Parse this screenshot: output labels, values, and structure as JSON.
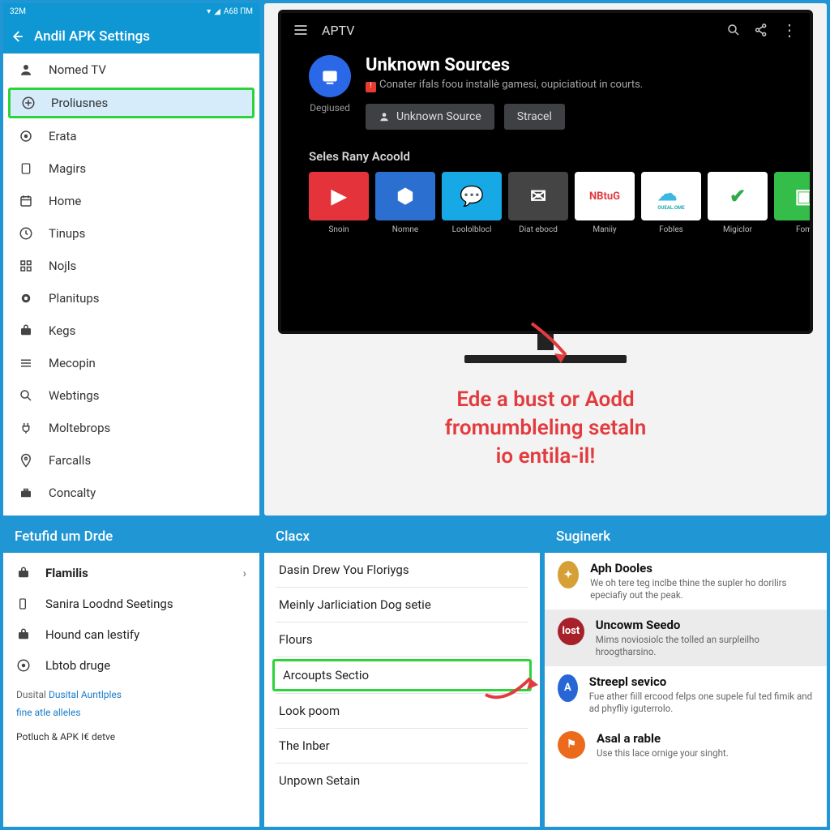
{
  "phone": {
    "status_time": "32M",
    "status_extra": "A68 ПM",
    "appbar_title": "Andil APK Settings",
    "items": [
      {
        "icon": "person",
        "label": "Nomed TV"
      },
      {
        "icon": "plus-circle",
        "label": "Proliusnes",
        "selected": true
      },
      {
        "icon": "target",
        "label": "Erata"
      },
      {
        "icon": "page",
        "label": "Magirs"
      },
      {
        "icon": "calendar",
        "label": "Home"
      },
      {
        "icon": "clock",
        "label": "Tinups"
      },
      {
        "icon": "squares",
        "label": "Nojls"
      },
      {
        "icon": "dot",
        "label": "Planitups"
      },
      {
        "icon": "briefcase",
        "label": "Kegs"
      },
      {
        "icon": "stack",
        "label": "Mecopin"
      },
      {
        "icon": "magnify",
        "label": "Webtings"
      },
      {
        "icon": "plug",
        "label": "Moltebrops"
      },
      {
        "icon": "pin",
        "label": "Farcalls"
      },
      {
        "icon": "case",
        "label": "Concalty"
      }
    ]
  },
  "tv": {
    "title": "APTV",
    "src_title": "Unknown Sources",
    "src_sub": "Conater ifals foou installè gamesi, oupiciatiout in courts.",
    "btn_primary": "Unknown Source",
    "btn_secondary": "Stracel",
    "degiused": "Degiused",
    "row_head": "Seles Rany Acoold",
    "apps": [
      {
        "label": "Snoin",
        "bg": "#e4333a",
        "sym": "▶"
      },
      {
        "label": "Nomne",
        "bg": "#2b6fd1",
        "sym": "⬢"
      },
      {
        "label": "Loololblocl",
        "bg": "#17a8e6",
        "sym": "💬"
      },
      {
        "label": "Diat ebocd",
        "bg": "#444",
        "sym": "✉"
      },
      {
        "label": "Maniiy",
        "bg": "#ffffff",
        "sym": "NBtuG",
        "fg": "#e23b3e"
      },
      {
        "label": "Fobles",
        "bg": "#fff",
        "sym": "☁",
        "fg": "#3ab7e3",
        "extra": "OUEAL.OME"
      },
      {
        "label": "Migiclor",
        "bg": "#fff",
        "sym": "✔",
        "fg": "#2faa4a"
      },
      {
        "label": "Fom",
        "bg": "#34bd48",
        "sym": "▣"
      }
    ],
    "callout_l1": "Ede a bust or Aodd",
    "callout_l2": "fromumbleling setaln",
    "callout_l3": "io entila-il!"
  },
  "bl": {
    "header": "Fetufid um Drde",
    "rows": [
      {
        "icon": "briefcase",
        "label": "Flamilis",
        "bold": true,
        "chev": true
      },
      {
        "icon": "phone",
        "label": "Sanira Loodnd Seetings"
      },
      {
        "icon": "briefcase",
        "label": "Hound can lestify"
      },
      {
        "icon": "clock-o",
        "label": "Lbtob druge"
      }
    ],
    "foot1": "Dusital Auntlples",
    "foot2": "fine atle alleles",
    "foot3": "Potluch & APK I€ detve"
  },
  "bm": {
    "header": "Clacx",
    "items": [
      "Dasin Drew You Floriygs",
      "Meinly Jarliciation Dog setie",
      "Flours",
      "Arcoupts Sectio",
      "Look poom",
      "The Inber",
      "Unpown Setain"
    ],
    "highlight_index": 3
  },
  "br": {
    "header": "Suginerk",
    "items": [
      {
        "bg": "#d6a036",
        "sym": "✦",
        "title": "Aph Dooles",
        "sub": "We oh tere teg inclbe thine the supler ho dorilirs epeciafiy out the peak."
      },
      {
        "bg": "#a6212a",
        "sym": "lost",
        "title": "Uncowm Seedo",
        "sub": "Mims noviosiolc the tolled an surpleilho hroogtharsino.",
        "selected": true
      },
      {
        "bg": "#2766d4",
        "sym": "A",
        "title": "Streepl sevico",
        "sub": "Fue ather fiill ercood felps one supele ful ted fimik and ad phyfliy iguterrolo."
      },
      {
        "bg": "#ec6a1b",
        "sym": "⚑",
        "title": "Asal a rable",
        "sub": "Use this lace ornige your singht."
      }
    ]
  }
}
